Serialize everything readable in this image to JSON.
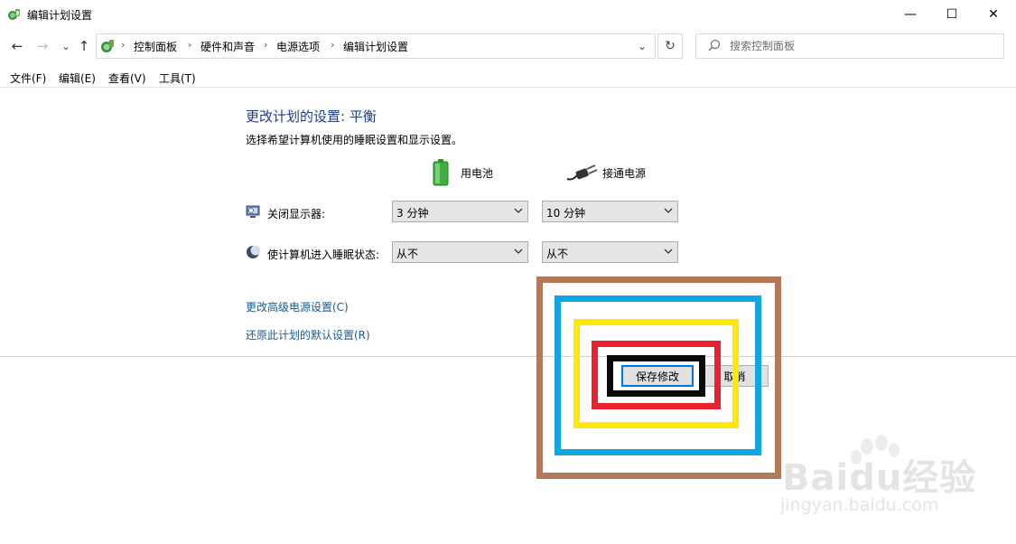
{
  "window": {
    "title": "编辑计划设置",
    "minimize_glyph": "—",
    "maximize_glyph": "☐",
    "close_glyph": "✕",
    "icon": "power-options-icon"
  },
  "nav": {
    "back_glyph": "←",
    "forward_glyph": "→",
    "recent_glyph": "⌄",
    "up_glyph": "↑",
    "refresh_glyph": "↻",
    "dropdown_glyph": "⌄"
  },
  "breadcrumb": [
    "控制面板",
    "硬件和声音",
    "电源选项",
    "编辑计划设置"
  ],
  "breadcrumb_sep": "›",
  "search": {
    "placeholder": "搜索控制面板"
  },
  "menu": [
    "文件(F)",
    "编辑(E)",
    "查看(V)",
    "工具(T)"
  ],
  "content": {
    "title": "更改计划的设置: 平衡",
    "subtitle": "选择希望计算机使用的睡眠设置和显示设置。",
    "columns": {
      "battery": "用电池",
      "plugged": "接通电源"
    },
    "rows": [
      {
        "label": "关闭显示器:",
        "battery": "3 分钟",
        "plugged": "10 分钟"
      },
      {
        "label": "使计算机进入睡眠状态:",
        "battery": "从不",
        "plugged": "从不"
      }
    ],
    "links": {
      "advanced": "更改高级电源设置(C)",
      "restore": "还原此计划的默认设置(R)"
    }
  },
  "buttons": {
    "save": "保存修改",
    "cancel": "取消"
  },
  "colors": {
    "title_blue": "#1e3d8f",
    "link_blue": "#1a5a96",
    "highlight_brown": "#b3795a",
    "highlight_blue": "#11a6e0",
    "highlight_yellow": "#ffe70a",
    "highlight_red": "#e8222f",
    "highlight_black": "#0a0a0a"
  },
  "watermark": {
    "brand": "Baidu经验",
    "domain": "jingyan.baidu.com"
  }
}
